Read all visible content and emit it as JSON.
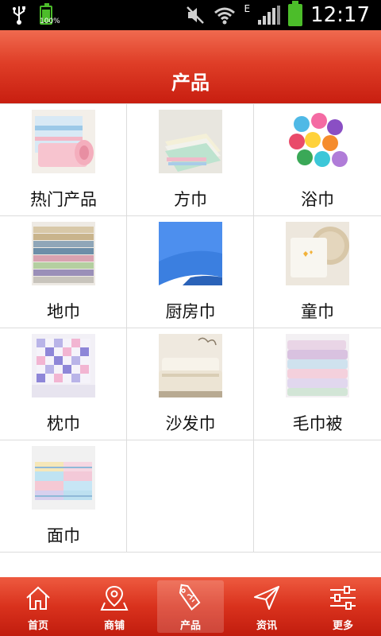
{
  "status_bar": {
    "time": "12:17",
    "battery_percent": "100%",
    "network_type": "E"
  },
  "header": {
    "title": "产品"
  },
  "products": [
    {
      "label": "热门产品",
      "thumb": "towel-stack-pastel"
    },
    {
      "label": "方巾",
      "thumb": "square-towels-stack"
    },
    {
      "label": "浴巾",
      "thumb": "colorful-towel-rolls"
    },
    {
      "label": "地巾",
      "thumb": "towel-shelf-stack"
    },
    {
      "label": "厨房巾",
      "thumb": "blue-microfiber-cloth"
    },
    {
      "label": "童巾",
      "thumb": "child-towel-basket"
    },
    {
      "label": "枕巾",
      "thumb": "checked-pillow-towel"
    },
    {
      "label": "沙发巾",
      "thumb": "sofa-cover"
    },
    {
      "label": "毛巾被",
      "thumb": "towel-blanket-stack"
    },
    {
      "label": "面巾",
      "thumb": "face-towels-stack"
    }
  ],
  "tabs": [
    {
      "label": "首页",
      "icon": "home-icon",
      "active": false
    },
    {
      "label": "商铺",
      "icon": "map-pin-icon",
      "active": false
    },
    {
      "label": "产品",
      "icon": "sale-tag-icon",
      "active": true
    },
    {
      "label": "资讯",
      "icon": "paper-plane-icon",
      "active": false
    },
    {
      "label": "更多",
      "icon": "sliders-icon",
      "active": false
    }
  ],
  "colors": {
    "header_red": "#d9321d",
    "tabbar_red": "#d9321d",
    "divider": "#dcdcdc",
    "battery_green": "#4cbd2a"
  }
}
